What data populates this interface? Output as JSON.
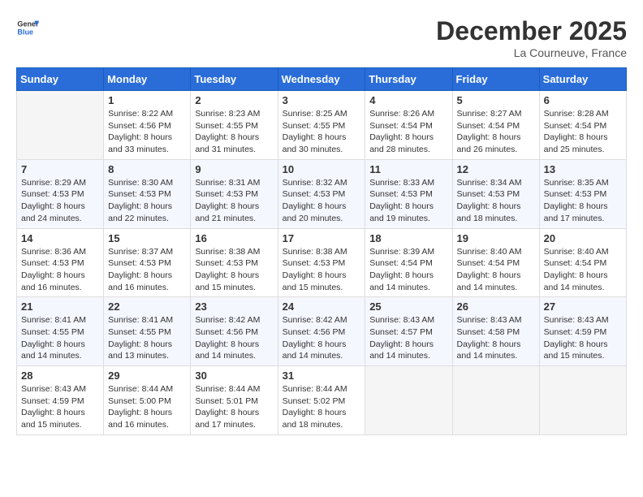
{
  "header": {
    "logo_line1": "General",
    "logo_line2": "Blue",
    "month": "December 2025",
    "location": "La Courneuve, France"
  },
  "days_of_week": [
    "Sunday",
    "Monday",
    "Tuesday",
    "Wednesday",
    "Thursday",
    "Friday",
    "Saturday"
  ],
  "weeks": [
    [
      {
        "day": "",
        "info": ""
      },
      {
        "day": "1",
        "info": "Sunrise: 8:22 AM\nSunset: 4:56 PM\nDaylight: 8 hours\nand 33 minutes."
      },
      {
        "day": "2",
        "info": "Sunrise: 8:23 AM\nSunset: 4:55 PM\nDaylight: 8 hours\nand 31 minutes."
      },
      {
        "day": "3",
        "info": "Sunrise: 8:25 AM\nSunset: 4:55 PM\nDaylight: 8 hours\nand 30 minutes."
      },
      {
        "day": "4",
        "info": "Sunrise: 8:26 AM\nSunset: 4:54 PM\nDaylight: 8 hours\nand 28 minutes."
      },
      {
        "day": "5",
        "info": "Sunrise: 8:27 AM\nSunset: 4:54 PM\nDaylight: 8 hours\nand 26 minutes."
      },
      {
        "day": "6",
        "info": "Sunrise: 8:28 AM\nSunset: 4:54 PM\nDaylight: 8 hours\nand 25 minutes."
      }
    ],
    [
      {
        "day": "7",
        "info": "Sunrise: 8:29 AM\nSunset: 4:53 PM\nDaylight: 8 hours\nand 24 minutes."
      },
      {
        "day": "8",
        "info": "Sunrise: 8:30 AM\nSunset: 4:53 PM\nDaylight: 8 hours\nand 22 minutes."
      },
      {
        "day": "9",
        "info": "Sunrise: 8:31 AM\nSunset: 4:53 PM\nDaylight: 8 hours\nand 21 minutes."
      },
      {
        "day": "10",
        "info": "Sunrise: 8:32 AM\nSunset: 4:53 PM\nDaylight: 8 hours\nand 20 minutes."
      },
      {
        "day": "11",
        "info": "Sunrise: 8:33 AM\nSunset: 4:53 PM\nDaylight: 8 hours\nand 19 minutes."
      },
      {
        "day": "12",
        "info": "Sunrise: 8:34 AM\nSunset: 4:53 PM\nDaylight: 8 hours\nand 18 minutes."
      },
      {
        "day": "13",
        "info": "Sunrise: 8:35 AM\nSunset: 4:53 PM\nDaylight: 8 hours\nand 17 minutes."
      }
    ],
    [
      {
        "day": "14",
        "info": "Sunrise: 8:36 AM\nSunset: 4:53 PM\nDaylight: 8 hours\nand 16 minutes."
      },
      {
        "day": "15",
        "info": "Sunrise: 8:37 AM\nSunset: 4:53 PM\nDaylight: 8 hours\nand 16 minutes."
      },
      {
        "day": "16",
        "info": "Sunrise: 8:38 AM\nSunset: 4:53 PM\nDaylight: 8 hours\nand 15 minutes."
      },
      {
        "day": "17",
        "info": "Sunrise: 8:38 AM\nSunset: 4:53 PM\nDaylight: 8 hours\nand 15 minutes."
      },
      {
        "day": "18",
        "info": "Sunrise: 8:39 AM\nSunset: 4:54 PM\nDaylight: 8 hours\nand 14 minutes."
      },
      {
        "day": "19",
        "info": "Sunrise: 8:40 AM\nSunset: 4:54 PM\nDaylight: 8 hours\nand 14 minutes."
      },
      {
        "day": "20",
        "info": "Sunrise: 8:40 AM\nSunset: 4:54 PM\nDaylight: 8 hours\nand 14 minutes."
      }
    ],
    [
      {
        "day": "21",
        "info": "Sunrise: 8:41 AM\nSunset: 4:55 PM\nDaylight: 8 hours\nand 14 minutes."
      },
      {
        "day": "22",
        "info": "Sunrise: 8:41 AM\nSunset: 4:55 PM\nDaylight: 8 hours\nand 13 minutes."
      },
      {
        "day": "23",
        "info": "Sunrise: 8:42 AM\nSunset: 4:56 PM\nDaylight: 8 hours\nand 14 minutes."
      },
      {
        "day": "24",
        "info": "Sunrise: 8:42 AM\nSunset: 4:56 PM\nDaylight: 8 hours\nand 14 minutes."
      },
      {
        "day": "25",
        "info": "Sunrise: 8:43 AM\nSunset: 4:57 PM\nDaylight: 8 hours\nand 14 minutes."
      },
      {
        "day": "26",
        "info": "Sunrise: 8:43 AM\nSunset: 4:58 PM\nDaylight: 8 hours\nand 14 minutes."
      },
      {
        "day": "27",
        "info": "Sunrise: 8:43 AM\nSunset: 4:59 PM\nDaylight: 8 hours\nand 15 minutes."
      }
    ],
    [
      {
        "day": "28",
        "info": "Sunrise: 8:43 AM\nSunset: 4:59 PM\nDaylight: 8 hours\nand 15 minutes."
      },
      {
        "day": "29",
        "info": "Sunrise: 8:44 AM\nSunset: 5:00 PM\nDaylight: 8 hours\nand 16 minutes."
      },
      {
        "day": "30",
        "info": "Sunrise: 8:44 AM\nSunset: 5:01 PM\nDaylight: 8 hours\nand 17 minutes."
      },
      {
        "day": "31",
        "info": "Sunrise: 8:44 AM\nSunset: 5:02 PM\nDaylight: 8 hours\nand 18 minutes."
      },
      {
        "day": "",
        "info": ""
      },
      {
        "day": "",
        "info": ""
      },
      {
        "day": "",
        "info": ""
      }
    ]
  ]
}
